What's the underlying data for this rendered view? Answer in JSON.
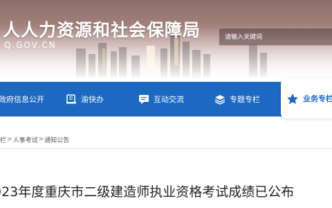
{
  "site": {
    "title": "人人力资源和社会保障局",
    "domain": "Q.GOV.CN"
  },
  "search": {
    "placeholder": "请输入关键词"
  },
  "nav": {
    "items": [
      {
        "label": "政府信息公开",
        "icon": "document-icon"
      },
      {
        "label": "渝快办",
        "icon": "book-icon"
      },
      {
        "label": "互动交流",
        "icon": "chat-icon"
      },
      {
        "label": "专题专栏",
        "icon": "layers-icon"
      }
    ],
    "active": {
      "label": "业务专栏",
      "icon": "star-icon"
    }
  },
  "breadcrumb": [
    "栏",
    "人事考试",
    "通知公告"
  ],
  "article": {
    "title": "023年度重庆市二级建造师执业资格考试成绩已公布"
  },
  "colors": {
    "nav": "#1d69c2",
    "active_text": "#1d69c2"
  }
}
